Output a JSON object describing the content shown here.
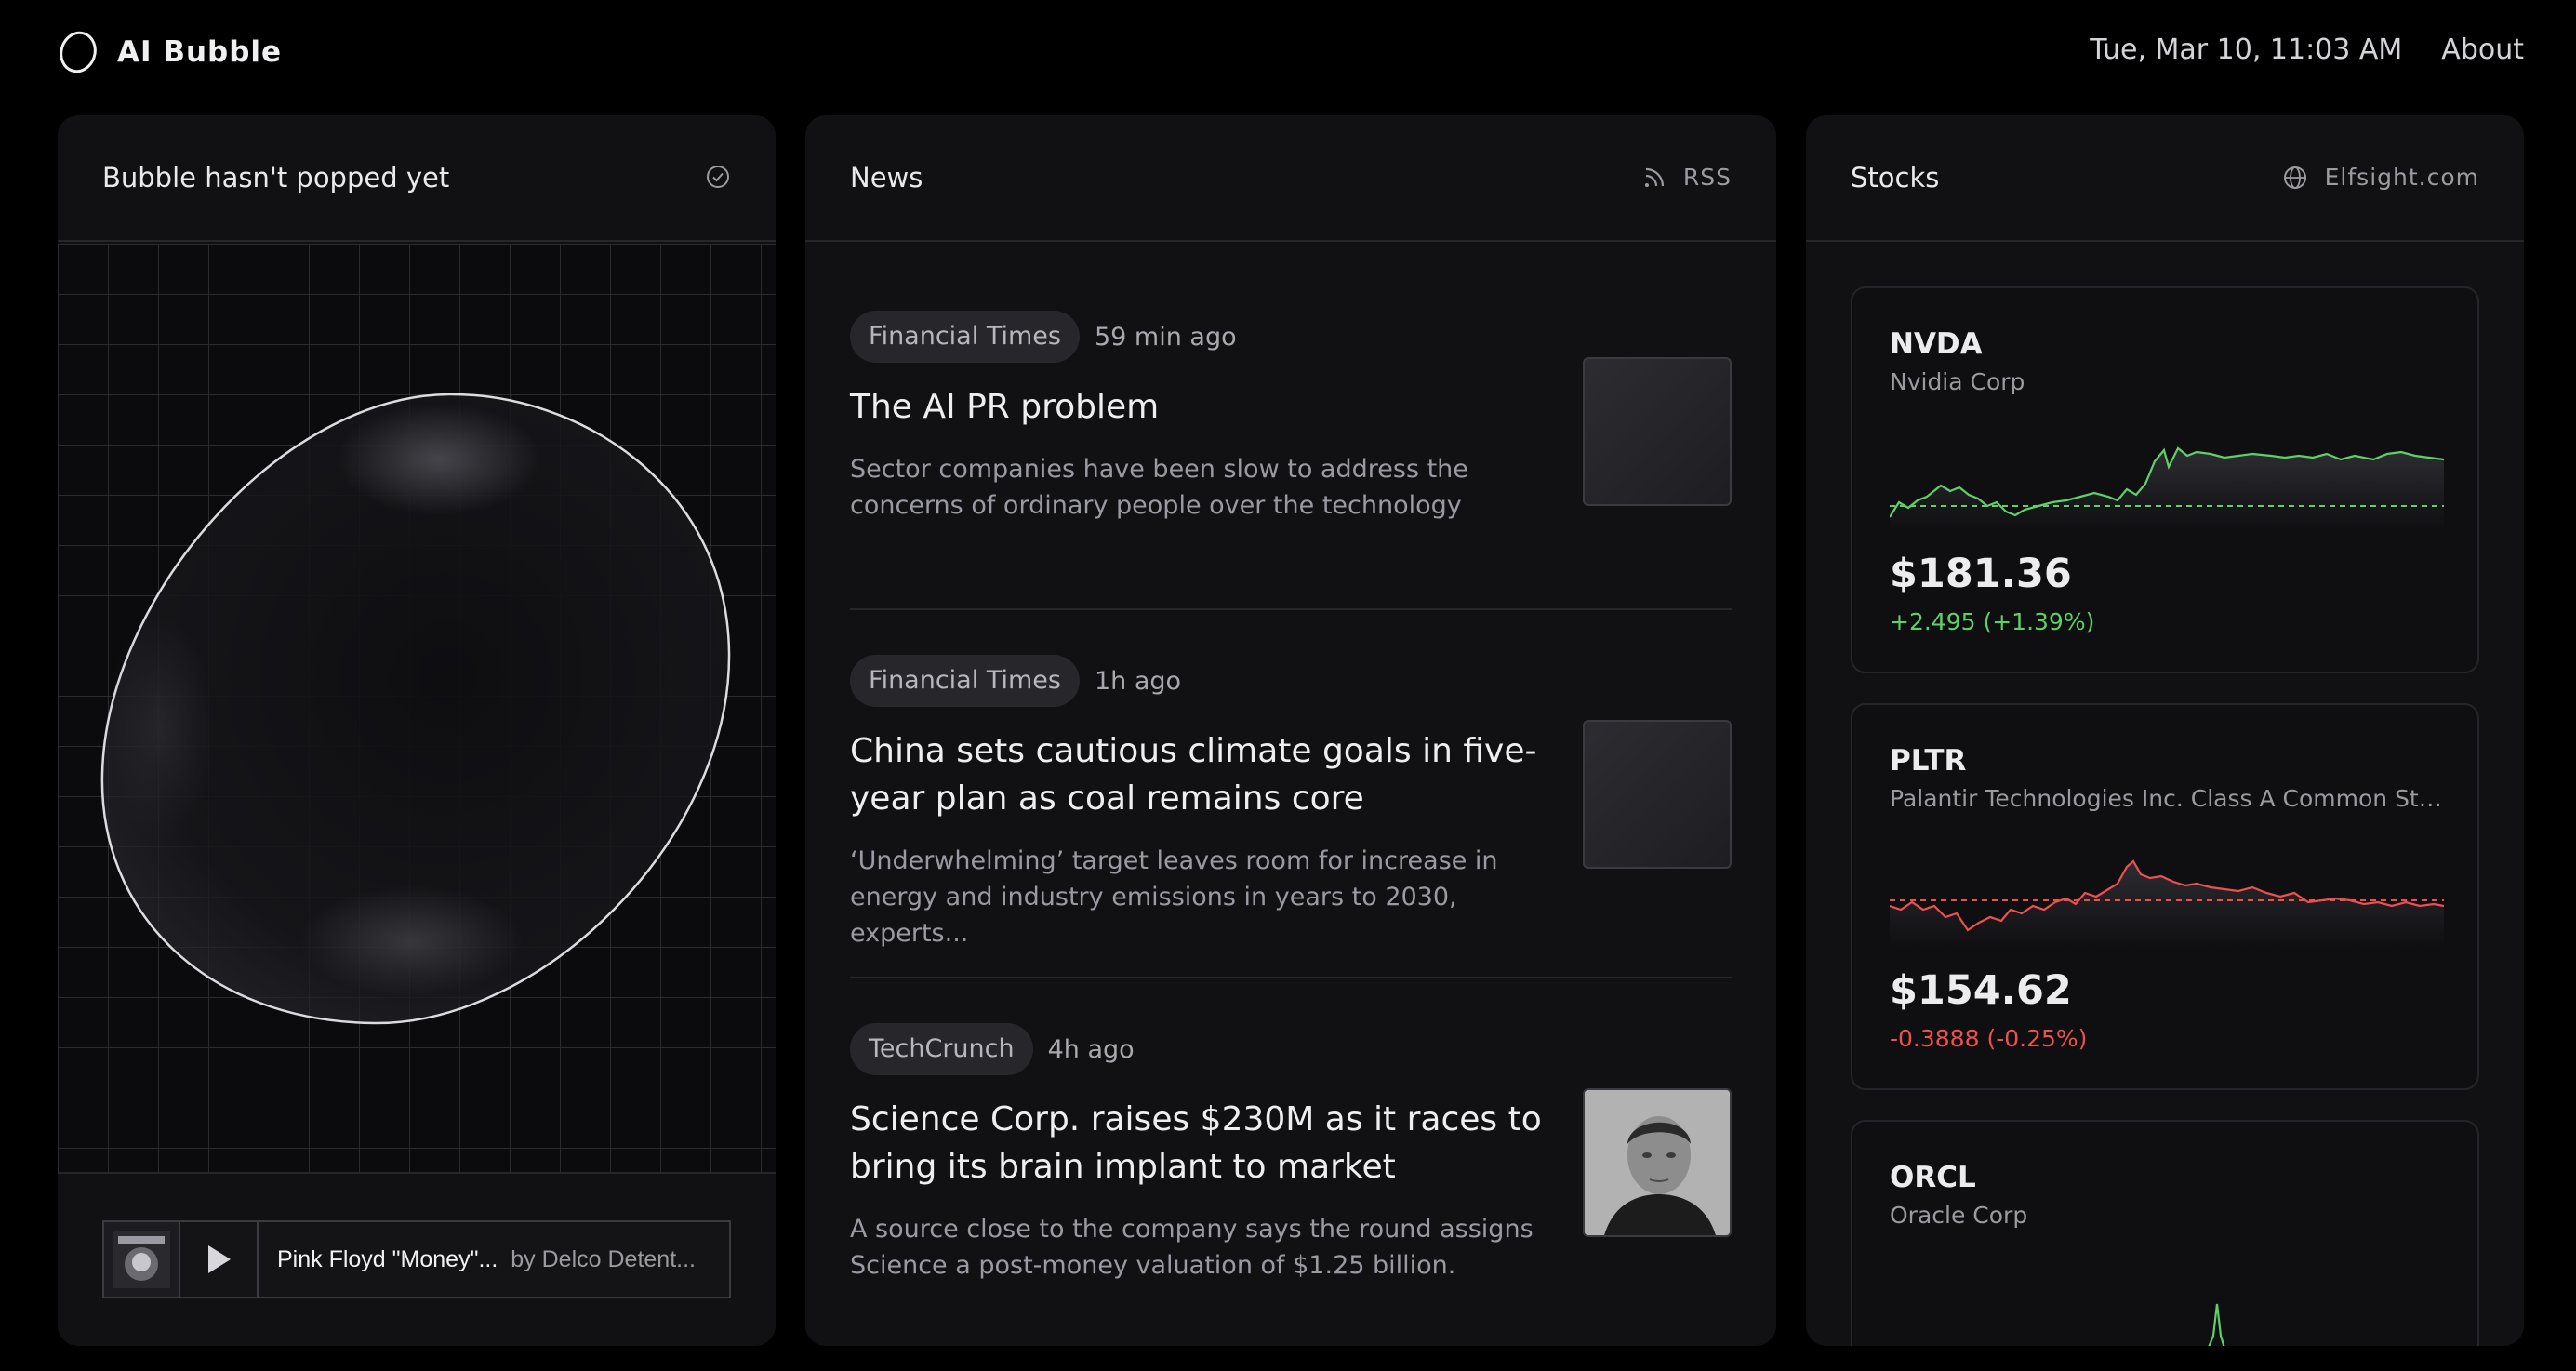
{
  "app": {
    "name": "AI Bubble"
  },
  "header": {
    "datetime": "Tue, Mar 10, 11:03 AM",
    "about_label": "About"
  },
  "bubble_panel": {
    "title": "Bubble hasn't popped yet",
    "player": {
      "track": "Pink Floyd \"Money\"...",
      "artist": "by Delco Detent..."
    }
  },
  "news_panel": {
    "title": "News",
    "action_label": "RSS",
    "items": [
      {
        "source": "Financial Times",
        "time": "59 min ago",
        "headline": "The AI PR problem",
        "summary": "Sector companies have been slow to address the concerns of ordinary people over the technology"
      },
      {
        "source": "Financial Times",
        "time": "1h ago",
        "headline": "China sets cautious climate goals in five-year plan as coal remains core",
        "summary": "‘Underwhelming’ target leaves room for increase in energy and industry emissions in years to 2030, experts..."
      },
      {
        "source": "TechCrunch",
        "time": "4h ago",
        "headline": "Science Corp. raises $230M as it races to bring its brain implant to market",
        "summary": "A source close to the company says the round assigns Science a post-money valuation of $1.25 billion."
      }
    ]
  },
  "stocks_panel": {
    "title": "Stocks",
    "action_label": "Elfsight.com",
    "items": [
      {
        "ticker": "NVDA",
        "name": "Nvidia Corp",
        "price": "$181.36",
        "change": "+2.495 (+1.39%)",
        "direction": "up"
      },
      {
        "ticker": "PLTR",
        "name": "Palantir Technologies Inc. Class A Common Sto...",
        "price": "$154.62",
        "change": "-0.3888 (-0.25%)",
        "direction": "down"
      },
      {
        "ticker": "ORCL",
        "name": "Oracle Corp",
        "price": "",
        "change": "",
        "direction": "up"
      }
    ]
  },
  "colors": {
    "up": "#5fd068",
    "down": "#ef4f4f",
    "panel_bg": "#111114"
  }
}
